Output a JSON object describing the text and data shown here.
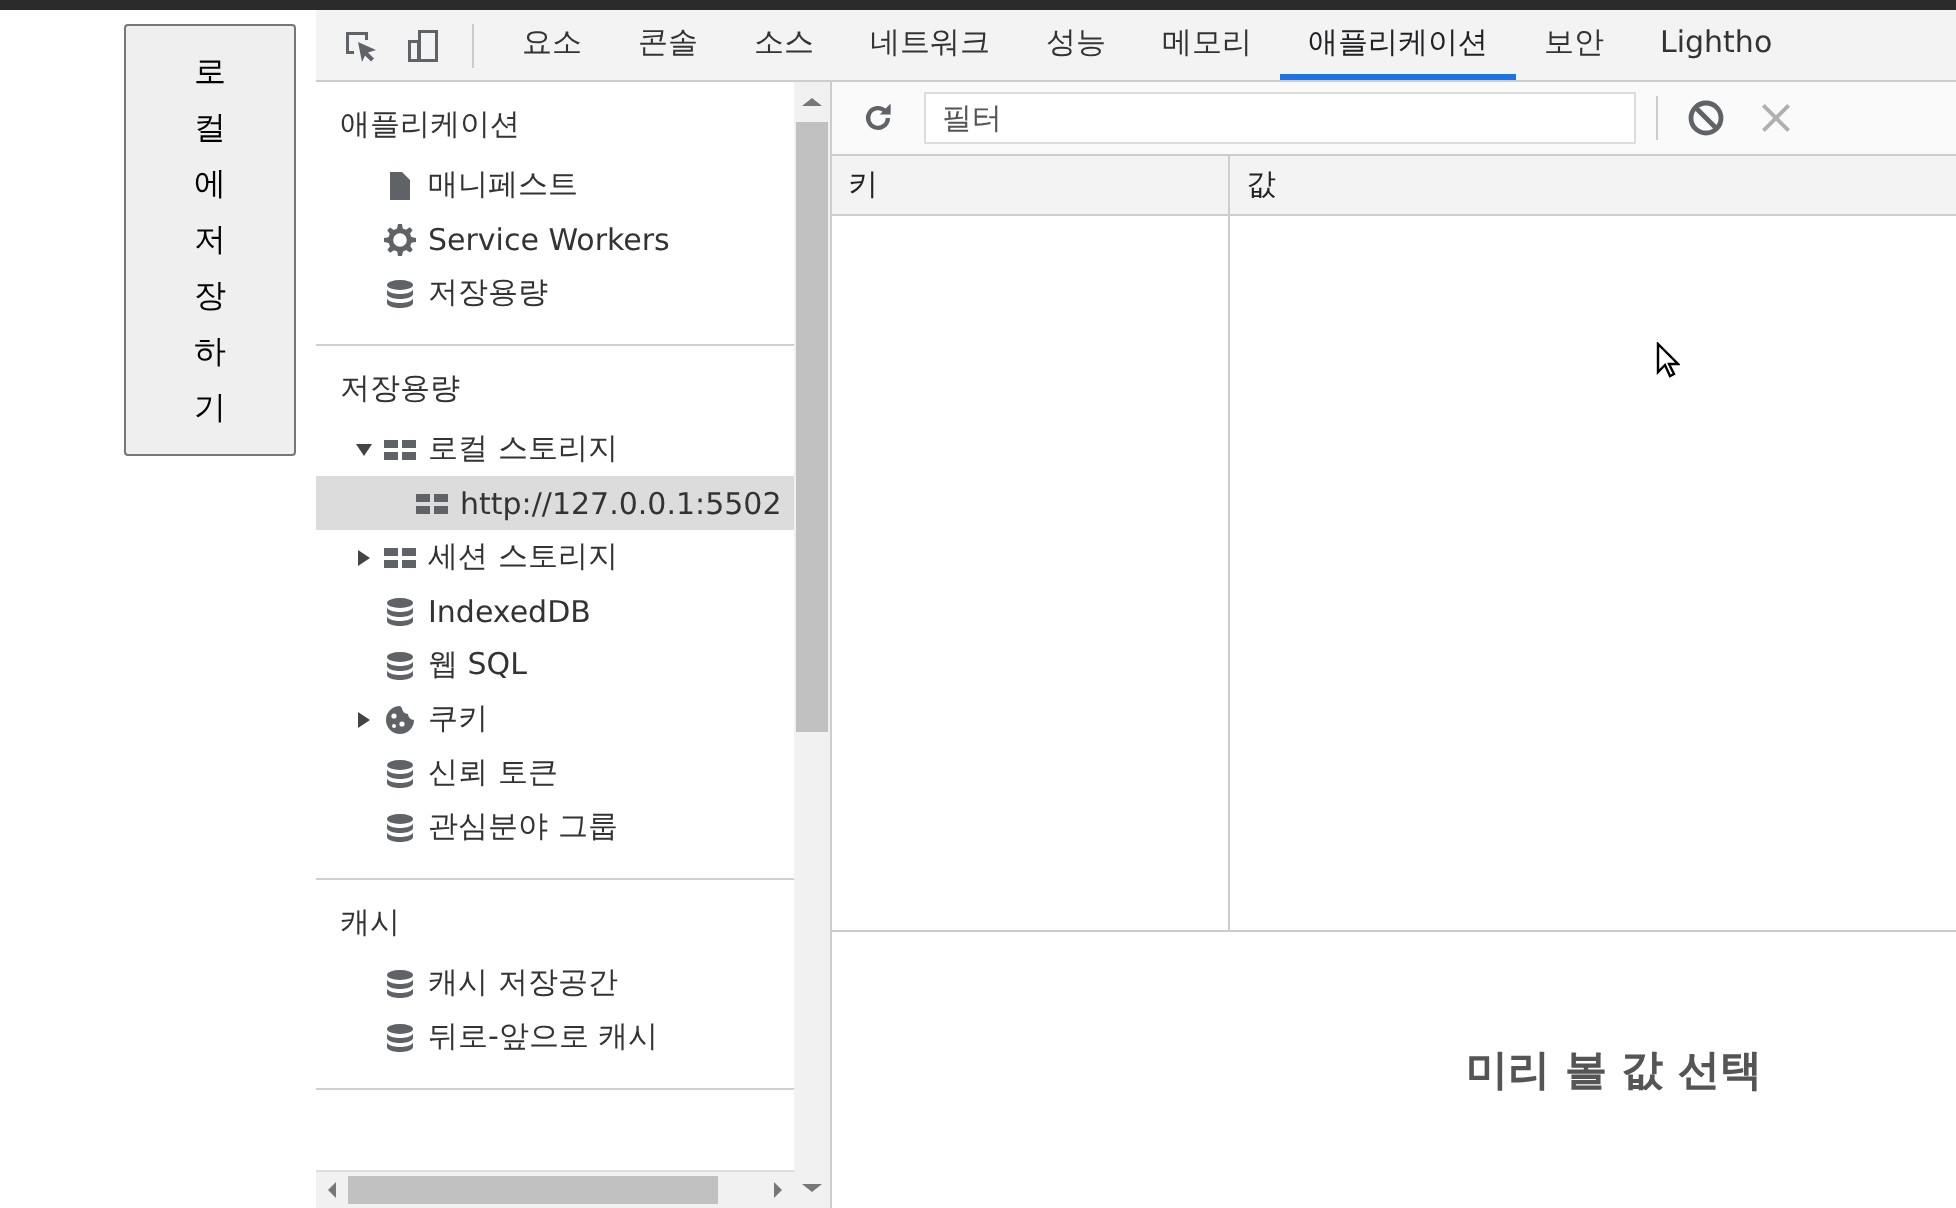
{
  "page_button": {
    "label": "로컬에저장하기"
  },
  "tabs": [
    {
      "label": "요소",
      "selected": false
    },
    {
      "label": "콘솔",
      "selected": false
    },
    {
      "label": "소스",
      "selected": false
    },
    {
      "label": "네트워크",
      "selected": false
    },
    {
      "label": "성능",
      "selected": false
    },
    {
      "label": "메모리",
      "selected": false
    },
    {
      "label": "애플리케이션",
      "selected": true
    },
    {
      "label": "보안",
      "selected": false
    },
    {
      "label": "Lightho",
      "selected": false
    }
  ],
  "sidebar": {
    "sections": [
      {
        "title": "애플리케이션",
        "items": [
          {
            "label": "매니페스트",
            "kind": "file",
            "selected": false
          },
          {
            "label": "Service Workers",
            "kind": "gear",
            "selected": false
          },
          {
            "label": "저장용량",
            "kind": "database",
            "selected": false
          }
        ]
      },
      {
        "title": "저장용량",
        "items": [
          {
            "label": "로컬 스토리지",
            "kind": "grid",
            "selected": false,
            "expanded": true,
            "children": [
              {
                "label": "http://127.0.0.1:5502",
                "kind": "grid",
                "selected": true
              }
            ]
          },
          {
            "label": "세션 스토리지",
            "kind": "grid",
            "selected": false,
            "expanded": false
          },
          {
            "label": "IndexedDB",
            "kind": "database",
            "selected": false
          },
          {
            "label": "웹 SQL",
            "kind": "database",
            "selected": false
          },
          {
            "label": "쿠키",
            "kind": "cookie",
            "selected": false,
            "expanded": false
          },
          {
            "label": "신뢰 토큰",
            "kind": "database",
            "selected": false
          },
          {
            "label": "관심분야 그룹",
            "kind": "database",
            "selected": false
          }
        ]
      },
      {
        "title": "캐시",
        "items": [
          {
            "label": "캐시 저장공간",
            "kind": "database",
            "selected": false
          },
          {
            "label": "뒤로-앞으로 캐시",
            "kind": "database",
            "selected": false
          }
        ]
      }
    ]
  },
  "filter": {
    "placeholder": "필터"
  },
  "table": {
    "columns": [
      "키",
      "값"
    ]
  },
  "preview": {
    "message": "미리 볼 값 선택"
  }
}
